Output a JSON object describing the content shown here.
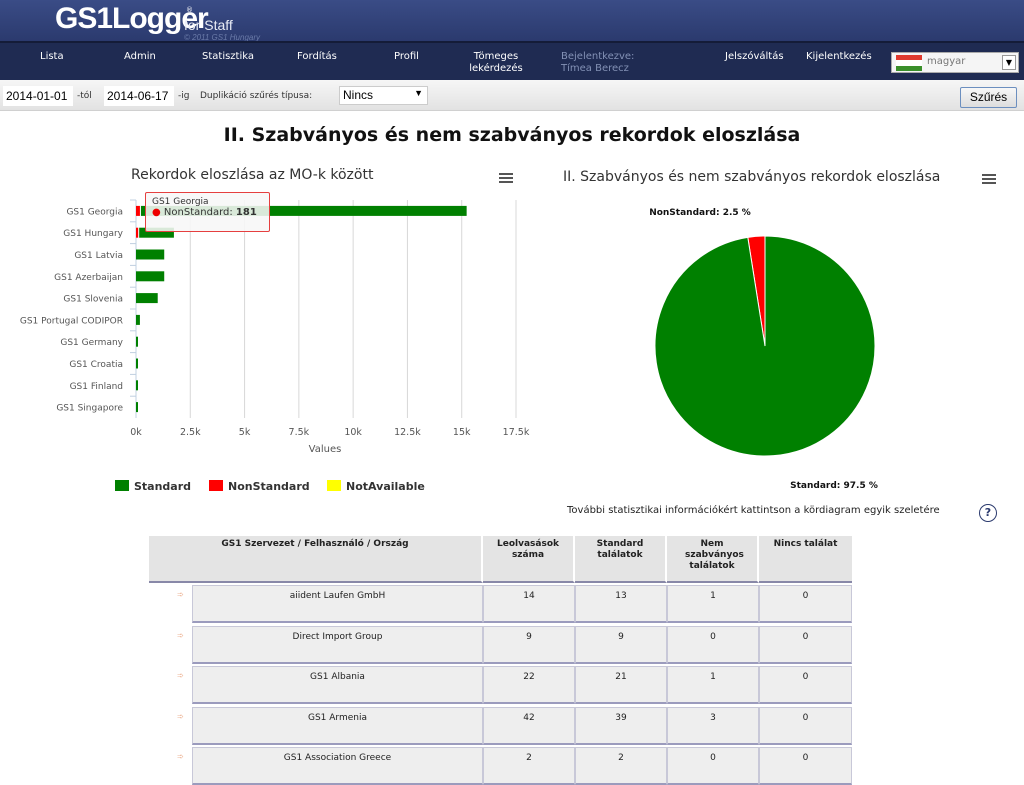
{
  "header": {
    "logo_main": "GS1Logger",
    "logo_sub": "for Staff",
    "logo_reg": "®",
    "copyright": "© 2011 GS1 Hungary"
  },
  "nav": {
    "items": [
      {
        "label": "Lista"
      },
      {
        "label": "Admin"
      },
      {
        "label": "Statisztika"
      },
      {
        "label": "Fordítás"
      },
      {
        "label": "Profil"
      },
      {
        "label": "Tömeges lekérdezés"
      }
    ],
    "logged_in_label": "Bejelentkezve:",
    "logged_in_user": "Tímea Berecz",
    "password_change": "Jelszóváltás",
    "logout": "Kijelentkezés",
    "language": "magyar",
    "flag_colors": [
      "#e03a2e",
      "#ffffff",
      "#3a8f2a"
    ]
  },
  "filters": {
    "date_from": "2014-01-01",
    "from_suffix": "-tól",
    "date_to": "2014-06-17",
    "to_suffix": "-ig",
    "dup_label": "Duplikáció szűrés típusa:",
    "dup_value": "Nincs",
    "filter_button": "Szűrés"
  },
  "page_title": "II. Szabványos és nem szabványos rekordok eloszlása",
  "colors": {
    "standard": "#008000",
    "nonstandard": "#ff0000",
    "notavailable": "#ffff00",
    "grid": "#d8d8d8"
  },
  "chart_data": [
    {
      "type": "bar",
      "orientation": "horizontal",
      "stacked": true,
      "title": "Rekordok eloszlása az MO-k között",
      "xlabel": "Values",
      "ylabel": "",
      "xlim": [
        0,
        17500
      ],
      "xticks": [
        0,
        2500,
        5000,
        7500,
        10000,
        12500,
        15000,
        17500
      ],
      "xtick_labels": [
        "0k",
        "2.5k",
        "5k",
        "7.5k",
        "10k",
        "12.5k",
        "15k",
        "17.5k"
      ],
      "grid": true,
      "legend_position": "bottom",
      "categories": [
        "GS1 Georgia",
        "GS1 Hungary",
        "GS1 Latvia",
        "GS1 Azerbaijan",
        "GS1 Slovenia",
        "GS1 Portugal CODIPOR",
        "GS1 Germany",
        "GS1 Croatia",
        "GS1 Finland",
        "GS1 Singapore"
      ],
      "series": [
        {
          "name": "Standard",
          "values": [
            15000,
            1600,
            1300,
            1300,
            1000,
            180,
            80,
            30,
            30,
            30
          ]
        },
        {
          "name": "NonStandard",
          "values": [
            181,
            100,
            0,
            0,
            0,
            0,
            0,
            0,
            0,
            0
          ]
        },
        {
          "name": "NotAvailable",
          "values": [
            0,
            0,
            0,
            0,
            0,
            0,
            0,
            0,
            0,
            0
          ]
        }
      ],
      "tooltip": {
        "category": "GS1 Georgia",
        "series": "NonStandard",
        "label": "NonStandard: ",
        "value": "181"
      }
    },
    {
      "type": "pie",
      "title": "II. Szabványos és nem szabványos rekordok eloszlása",
      "slices": [
        {
          "name": "NonStandard",
          "value": 2.5,
          "label": "NonStandard: 2.5 %"
        },
        {
          "name": "Standard",
          "value": 97.5,
          "label": "Standard: 97.5 %"
        }
      ]
    }
  ],
  "legend": [
    "Standard",
    "NonStandard",
    "NotAvailable"
  ],
  "info_text": "További statisztikai információkért kattintson a kördiagram egyik szeletére",
  "help_icon": "?",
  "table": {
    "headers": [
      "GS1 Szervezet / Felhasználó / Ország",
      "Leolvasások száma",
      "Standard találatok",
      "Nem szabványos találatok",
      "Nincs találat"
    ],
    "rows": [
      {
        "name": "aiident Laufen GmbH",
        "reads": "14",
        "standard": "13",
        "nonstandard": "1",
        "none": "0"
      },
      {
        "name": "Direct Import Group",
        "reads": "9",
        "standard": "9",
        "nonstandard": "0",
        "none": "0"
      },
      {
        "name": "GS1 Albania",
        "reads": "22",
        "standard": "21",
        "nonstandard": "1",
        "none": "0"
      },
      {
        "name": "GS1 Armenia",
        "reads": "42",
        "standard": "39",
        "nonstandard": "3",
        "none": "0"
      },
      {
        "name": "GS1 Association Greece",
        "reads": "2",
        "standard": "2",
        "nonstandard": "0",
        "none": "0"
      }
    ]
  }
}
